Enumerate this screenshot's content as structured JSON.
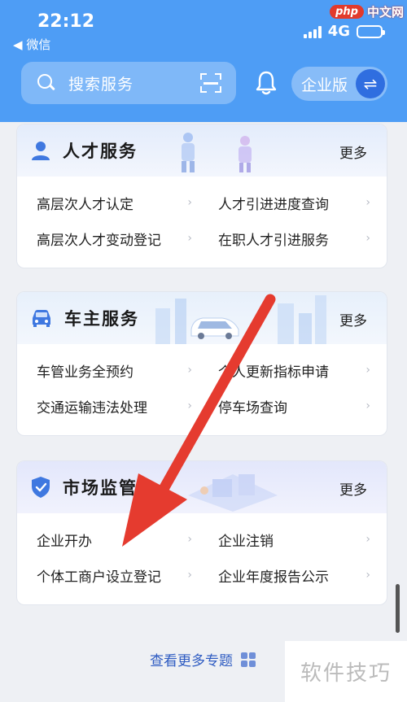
{
  "status": {
    "time": "22:12",
    "back_app": "微信",
    "network": "4G"
  },
  "header": {
    "search_placeholder": "搜索服务",
    "enterprise_label": "企业版"
  },
  "cards": [
    {
      "title": "人才服务",
      "more": "更多",
      "items": [
        [
          "高层次人才认定",
          "人才引进进度查询"
        ],
        [
          "高层次人才变动登记",
          "在职人才引进服务"
        ]
      ]
    },
    {
      "title": "车主服务",
      "more": "更多",
      "items": [
        [
          "车管业务全预约",
          "个人更新指标申请"
        ],
        [
          "交通运输违法处理",
          "停车场查询"
        ]
      ]
    },
    {
      "title": "市场监管",
      "more": "更多",
      "items": [
        [
          "企业开办",
          "企业注销"
        ],
        [
          "个体工商户设立登记",
          "企业年度报告公示"
        ]
      ]
    }
  ],
  "footer": {
    "more_topics": "查看更多专题"
  },
  "watermarks": {
    "top_badge": "php",
    "top_text": "中文网",
    "bottom_text": "软件技巧"
  },
  "colors": {
    "header_bg": "#4e9df5",
    "annotation_arrow": "#e53b2f",
    "link": "#2f5cc2"
  }
}
